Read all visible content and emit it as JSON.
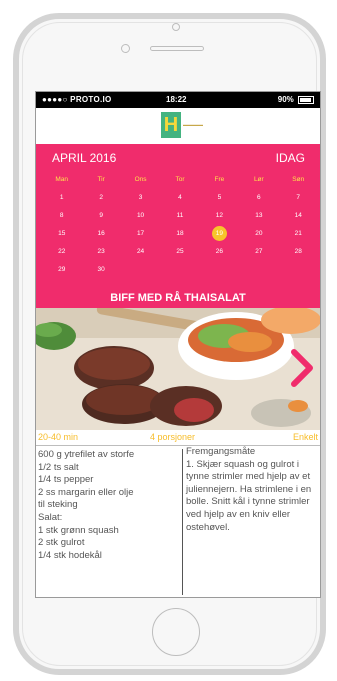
{
  "device": {
    "model": "iPhone",
    "color": "white"
  },
  "status_bar": {
    "carrier": "●●●●○ PROTO.IO",
    "time": "18:22",
    "battery": "90%"
  },
  "logo": {
    "letter": "H"
  },
  "calendar": {
    "month": "APRIL 2016",
    "today_label": "IDAG",
    "weekdays": [
      "Man",
      "Tir",
      "Ons",
      "Tor",
      "Fre",
      "Lør",
      "Søn"
    ],
    "weeks": [
      [
        "1",
        "2",
        "3",
        "4",
        "5",
        "6",
        "7"
      ],
      [
        "8",
        "9",
        "10",
        "11",
        "12",
        "13",
        "14"
      ],
      [
        "15",
        "16",
        "17",
        "18",
        "19",
        "20",
        "21"
      ],
      [
        "22",
        "23",
        "24",
        "25",
        "26",
        "27",
        "28"
      ],
      [
        "29",
        "30",
        "",
        "",
        "",
        "",
        ""
      ]
    ],
    "selected_day": "19",
    "colors": {
      "background": "#f02c6c",
      "weekday": "#ffe24a",
      "selected": "#f7c52b"
    }
  },
  "recipe": {
    "title": "BIFF MED RÅ THAISALAT",
    "time": "20-40 min",
    "portions": "4 porsjoner",
    "difficulty": "Enkelt",
    "ingredients": [
      "600 g ytrefilet av storfe",
      "1/2 ts salt",
      "1/4 ts pepper",
      "2 ss margarin eller olje",
      "til steking",
      "Salat:",
      "1 stk grønn squash",
      "2 stk gulrot",
      "1/4 stk hodekål"
    ],
    "method_title": "Fremgangsmåte",
    "method_text": "1. Skjær squash og gulrot i tynne strimler med hjelp av et julienne­jern. Ha strimlene i en bolle. Snitt kål i tynne strimler ved hjelp av en kniv eller ostehøvel."
  }
}
